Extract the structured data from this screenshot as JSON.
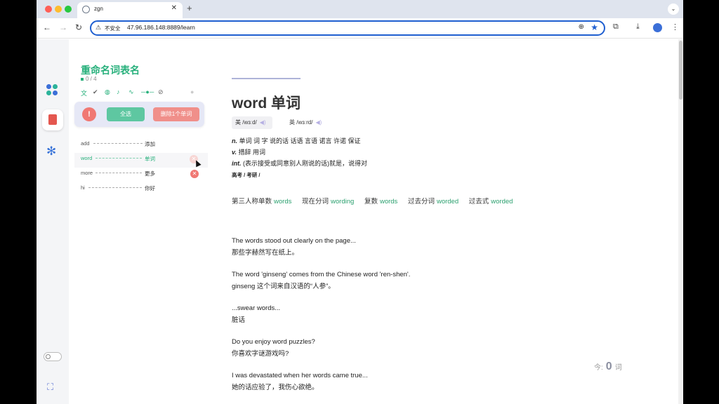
{
  "browser": {
    "tab_title": "zgn",
    "tab_close": "✕",
    "new_tab": "+",
    "insecure_label": "不安全",
    "url": "47.96.186.148:8889/learn"
  },
  "sidebar": {
    "list_title": "重命名词表名",
    "list_count": "0 / 4",
    "select_all_label": "全选",
    "delete_label": "删除1个单词",
    "alert_label": "!",
    "words": [
      {
        "word": "add",
        "meaning": "添加"
      },
      {
        "word": "word",
        "meaning": "单词"
      },
      {
        "word": "more",
        "meaning": "更多"
      },
      {
        "word": "hi",
        "meaning": "你好"
      }
    ]
  },
  "main": {
    "progress": 1.0,
    "word": "word 单词",
    "phonetic_us": "美 /wɜːd/",
    "phonetic_uk": "英 /wɜːrd/",
    "definitions": [
      {
        "pos": "n.",
        "text": "单词 词 字 说的话 话语 言语 诺言 许诺 保证"
      },
      {
        "pos": "v.",
        "text": "措辞 用词"
      },
      {
        "pos": "int.",
        "text": "(表示接受或同意别人刚说的话)就是，说得对"
      }
    ],
    "tags": "高考 / 考研 /",
    "forms": [
      {
        "label": "第三人称单数",
        "value": "words"
      },
      {
        "label": "现在分词",
        "value": "wording"
      },
      {
        "label": "复数",
        "value": "words"
      },
      {
        "label": "过去分词",
        "value": "worded"
      },
      {
        "label": "过去式",
        "value": "worded"
      }
    ],
    "sentences": [
      {
        "en": "The words stood out clearly on the page...",
        "zh": "那些字赫然写在纸上。"
      },
      {
        "en": "The word 'ginseng' comes from the Chinese word 'ren-shen'.",
        "zh": "ginseng 这个词来自汉语的“人参”。"
      },
      {
        "en": "...swear words...",
        "zh": "脏话"
      },
      {
        "en": "Do you enjoy word puzzles?",
        "zh": "你喜欢字谜游戏吗?"
      },
      {
        "en": "I was devastated when her words came true...",
        "zh": "她的话应验了，我伤心欲绝。"
      }
    ],
    "today_label": "今:",
    "today_count": "0",
    "today_unit": "词"
  },
  "colors": {
    "accent_green": "#27b07b",
    "danger_red": "#f07873",
    "brand_blue": "#1f5fd0"
  },
  "icons": [
    "translate-icon",
    "check-circle-icon",
    "mouse-icon",
    "music-icon",
    "waveform-icon",
    "slider-icon",
    "compass-icon",
    "help-icon"
  ]
}
